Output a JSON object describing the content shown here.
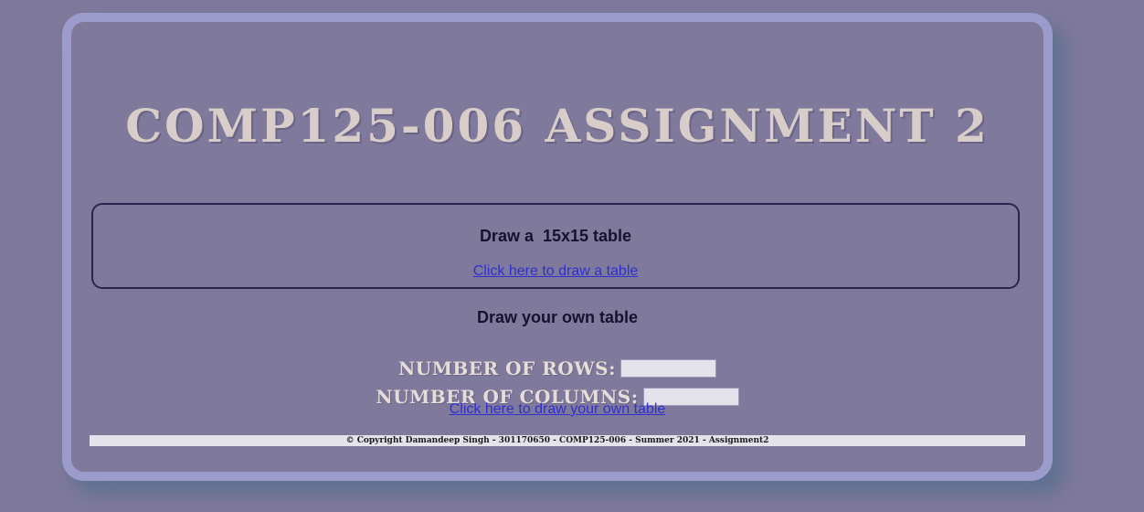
{
  "page": {
    "title": "COMP125-006 ASSIGNMENT 2"
  },
  "preset": {
    "heading": "Draw a  15x15 table",
    "link_label": "Click here to draw a table"
  },
  "custom": {
    "heading": "Draw your own table",
    "rows_label": "NUMBER OF ROWS:",
    "rows_value": "",
    "columns_label": "NUMBER OF COLUMNS:",
    "columns_value": "",
    "link_label": "Click here to draw your own table"
  },
  "footer": {
    "text": "© Copyright Damandeep Singh - 301170650 - COMP125-006 - Summer 2021 - Assignment2"
  },
  "colors": {
    "page_background": "#7f799b",
    "card_border": "#9b9bcc",
    "title_text": "#d8cdc8",
    "link": "#2f2fd0"
  }
}
